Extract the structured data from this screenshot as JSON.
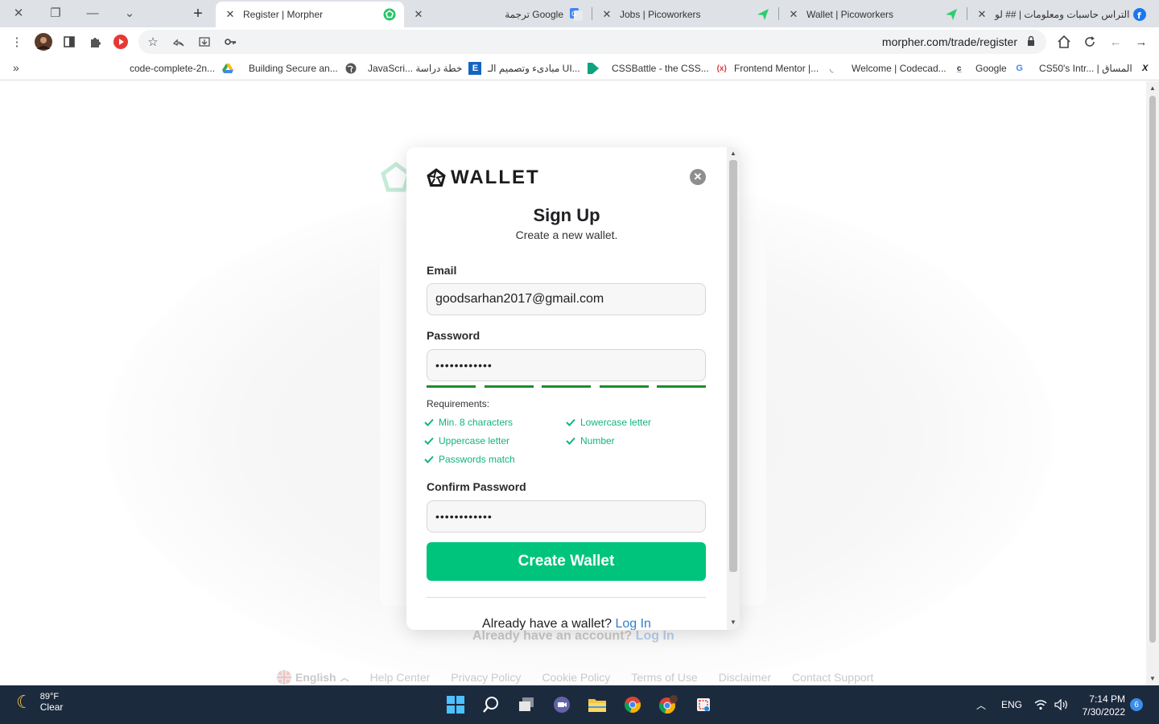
{
  "browser": {
    "tabs": [
      {
        "title": "Register | Morpher",
        "active": true
      },
      {
        "title": "ترجمة Google",
        "active": false
      },
      {
        "title": "Jobs | Picoworkers",
        "active": false
      },
      {
        "title": "Wallet | Picoworkers",
        "active": false
      },
      {
        "title": "التراس حاسبات ومعلومات | ## لو",
        "active": false
      }
    ],
    "url": "morpher.com/trade/register",
    "bookmarks": [
      {
        "label": "code-complete-2n...",
        "icon": "google-drive-icon"
      },
      {
        "label": "Building Secure an...",
        "icon": "globe-icon"
      },
      {
        "label": "JavaScri... خطة دراسة",
        "icon": "e-icon"
      },
      {
        "label": "مبادىء وتصميم الـ UI...",
        "icon": "k-icon"
      },
      {
        "label": "CSSBattle - the CSS...",
        "icon": "cssbattle-icon"
      },
      {
        "label": "Frontend Mentor |...",
        "icon": "frontend-mentor-icon"
      },
      {
        "label": "Welcome | Codecad...",
        "icon": "codecademy-icon"
      },
      {
        "label": "Google",
        "icon": "google-icon"
      },
      {
        "label": "CS50's Intr... | المساق",
        "icon": "edx-icon"
      }
    ]
  },
  "background_page": {
    "already_text": "Already have an account?",
    "login_link": "Log In",
    "footer": {
      "language": "English",
      "links": [
        "Help Center",
        "Privacy Policy",
        "Cookie Policy",
        "Terms of Use",
        "Disclaimer",
        "Contact Support"
      ]
    }
  },
  "modal": {
    "brand": "WALLET",
    "title": "Sign Up",
    "subtitle": "Create a new wallet.",
    "email_label": "Email",
    "email_value": "goodsarhan2017@gmail.com",
    "password_label": "Password",
    "password_value": "••••••••••••",
    "strength_segments_filled": 5,
    "requirements_title": "Requirements:",
    "requirements": [
      "Min. 8 characters",
      "Lowercase letter",
      "Uppercase letter",
      "Number",
      "Passwords match"
    ],
    "confirm_label": "Confirm Password",
    "confirm_value": "••••••••••••",
    "create_button": "Create Wallet",
    "already_text": "Already have a wallet?",
    "login_link": "Log In",
    "colors": {
      "accent": "#00c47c",
      "link": "#2f80d1",
      "check": "#11b57a",
      "strength": "#1e8c2c"
    }
  },
  "taskbar": {
    "temperature": "89°F",
    "condition": "Clear",
    "language": "ENG",
    "time": "7:14 PM",
    "date": "7/30/2022",
    "notifications": "6"
  }
}
